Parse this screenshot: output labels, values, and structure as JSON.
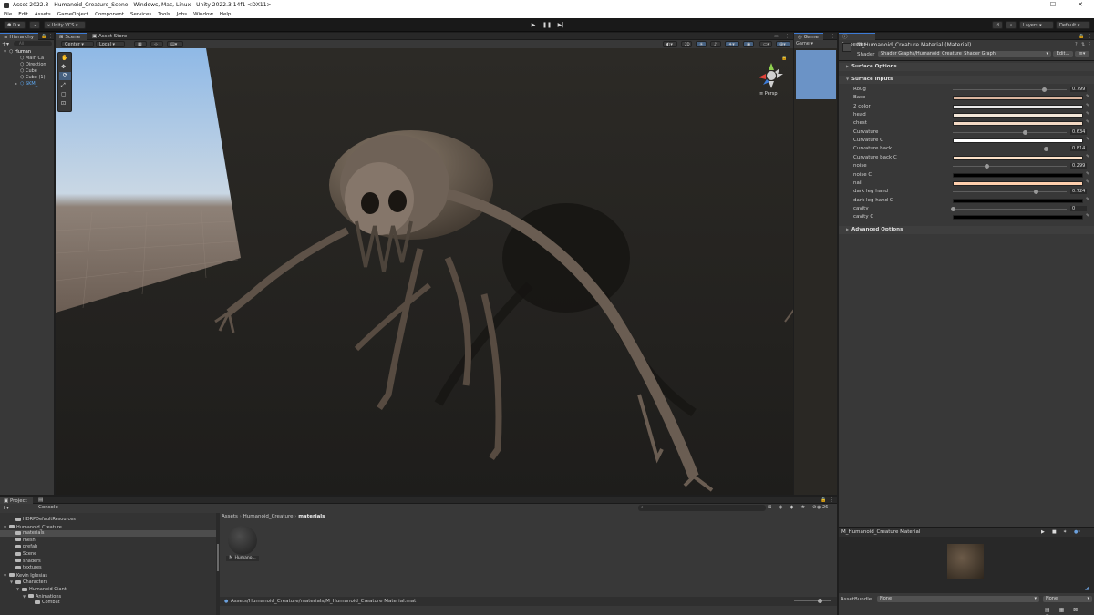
{
  "window": {
    "title": "Asset 2022.3 - Humanoid_Creature_Scene - Windows, Mac, Linux - Unity 2022.3.14f1 <DX11>",
    "controls": [
      "–",
      "☐",
      "✕"
    ]
  },
  "menu": [
    "File",
    "Edit",
    "Assets",
    "GameObject",
    "Component",
    "Services",
    "Tools",
    "Jobs",
    "Window",
    "Help"
  ],
  "toolbar": {
    "account": "D",
    "vcs": "Unity VCS",
    "layers": "Layers",
    "layout": "Default"
  },
  "hierarchy": {
    "tab": "Hierarchy",
    "search_placeholder": "All",
    "items": [
      {
        "label": "Human",
        "indent": 0
      },
      {
        "label": "Main Ca",
        "indent": 1
      },
      {
        "label": "Direction",
        "indent": 1
      },
      {
        "label": "Cube",
        "indent": 1
      },
      {
        "label": "Cube (1)",
        "indent": 1
      },
      {
        "label": "SKM_",
        "indent": 1
      }
    ]
  },
  "scene": {
    "tab_scene": "Scene",
    "tab_asset_store": "Asset Store",
    "pivot": "Center",
    "space": "Local",
    "view_mode": "2D",
    "persp_label": "Persp"
  },
  "game": {
    "tab": "Game",
    "display": "Game"
  },
  "inspector": {
    "tab": "Inspector",
    "material_name": "M_Humanoid_Creature Material (Material)",
    "shader_label": "Shader",
    "shader_value": "Shader Graphs/Humanoid_Creature_Shader Graph",
    "edit_button": "Edit...",
    "surface_options": "Surface Options",
    "surface_inputs": "Surface Inputs",
    "advanced_options": "Advanced Options",
    "properties": [
      {
        "label": "Roug",
        "kind": "slider",
        "value": "0.799",
        "fraction": 0.799
      },
      {
        "label": "Base",
        "kind": "color",
        "color": "#d9b59e"
      },
      {
        "label": "2 color",
        "kind": "color",
        "color": "#e8e8e8"
      },
      {
        "label": "head",
        "kind": "color",
        "color": "#f2e6d8"
      },
      {
        "label": "chest",
        "kind": "color",
        "color": "#f3d9c4"
      },
      {
        "label": "Curvature",
        "kind": "slider",
        "value": "0.634",
        "fraction": 0.634
      },
      {
        "label": "Curvature C",
        "kind": "color",
        "color": "#ffffff"
      },
      {
        "label": "Curvature back",
        "kind": "slider",
        "value": "0.814",
        "fraction": 0.814
      },
      {
        "label": "Curvature back C",
        "kind": "color",
        "color": "#fce1c8"
      },
      {
        "label": "noise",
        "kind": "slider",
        "value": "0.299",
        "fraction": 0.299
      },
      {
        "label": "noise C",
        "kind": "color",
        "color": "#000000"
      },
      {
        "label": "nail",
        "kind": "color",
        "color": "#ffcfad"
      },
      {
        "label": "dark leg hand",
        "kind": "slider",
        "value": "0.724",
        "fraction": 0.724
      },
      {
        "label": "dark leg hand C",
        "kind": "color",
        "color": "#000000"
      },
      {
        "label": "cavity",
        "kind": "slider",
        "value": "0",
        "fraction": 0.0
      },
      {
        "label": "cavity C",
        "kind": "color",
        "color": "#000000"
      }
    ],
    "preview_title": "M_Humanoid_Creature Material",
    "asset_bundle_label": "AssetBundle",
    "asset_bundle_value": "None",
    "asset_variant_value": "None"
  },
  "project": {
    "tab_project": "Project",
    "tab_console": "Console",
    "tree": [
      {
        "label": "HDRPDefaultResources",
        "indent": 1,
        "arrow": false
      },
      {
        "label": "Humanoid_Creature",
        "indent": 0,
        "arrow": true
      },
      {
        "label": "materials",
        "indent": 1,
        "arrow": false,
        "selected": true
      },
      {
        "label": "mesh",
        "indent": 1,
        "arrow": false
      },
      {
        "label": "prefab",
        "indent": 1,
        "arrow": false
      },
      {
        "label": "Scene",
        "indent": 1,
        "arrow": false
      },
      {
        "label": "shaders",
        "indent": 1,
        "arrow": false
      },
      {
        "label": "textures",
        "indent": 1,
        "arrow": false
      },
      {
        "label": "Kevin Iglesias",
        "indent": 0,
        "arrow": true
      },
      {
        "label": "Characters",
        "indent": 1,
        "arrow": true
      },
      {
        "label": "Humanoid Giant",
        "indent": 2,
        "arrow": true
      },
      {
        "label": "Animations",
        "indent": 3,
        "arrow": true
      },
      {
        "label": "Combat",
        "indent": 4,
        "arrow": false
      }
    ],
    "breadcrumb": [
      "Assets",
      "Humanoid_Creature",
      "materials"
    ],
    "asset_label": "M_Humano...",
    "path": "Assets/Humanoid_Creature/materials/M_Humanoid_Creature Material.mat",
    "hidden_count": "26"
  },
  "colors": {
    "accent": "#3d7bd6",
    "sky": "#9fc3e8",
    "ground": "#7a6d63"
  }
}
